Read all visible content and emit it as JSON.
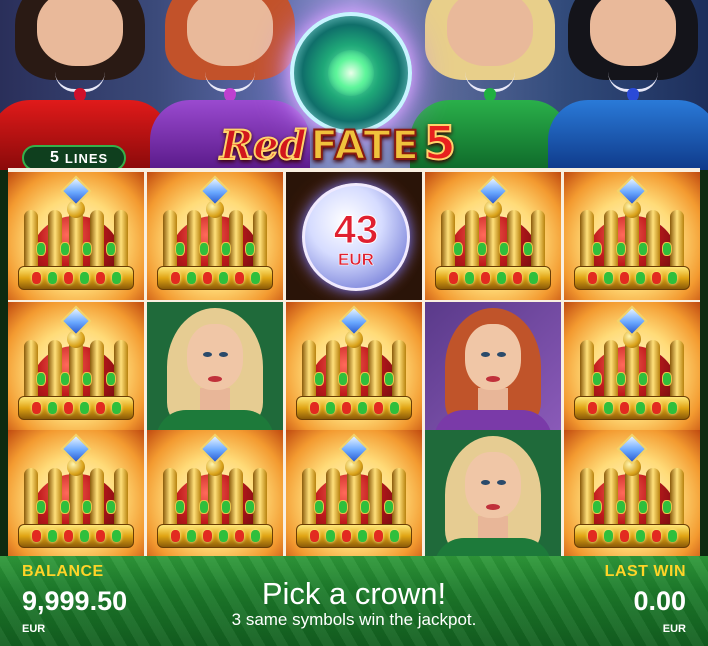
{
  "header": {
    "logo_word1": "Red",
    "logo_word2": "FATE",
    "logo_number": "5",
    "lines_count": "5",
    "lines_label": "LINES"
  },
  "jackpot": {
    "value": "43",
    "currency": "EUR"
  },
  "reels": {
    "grid": [
      [
        "crown",
        "crown",
        "jackpot-orb",
        "crown",
        "crown"
      ],
      [
        "crown",
        "blonde-lady",
        "crown",
        "redhead-lady",
        "crown"
      ],
      [
        "crown",
        "crown",
        "crown",
        "blonde-lady",
        "crown"
      ]
    ]
  },
  "status": {
    "balance_label": "BALANCE",
    "balance_value": "9,999.50",
    "balance_currency": "EUR",
    "message_title": "Pick a crown!",
    "message_subtitle": "3 same symbols win the jackpot.",
    "last_win_label": "LAST WIN",
    "last_win_value": "0.00",
    "last_win_currency": "EUR"
  },
  "colors": {
    "accent_gold": "#ffd428",
    "bar_green": "#1c7a2a",
    "jackpot_red": "#e02030"
  }
}
